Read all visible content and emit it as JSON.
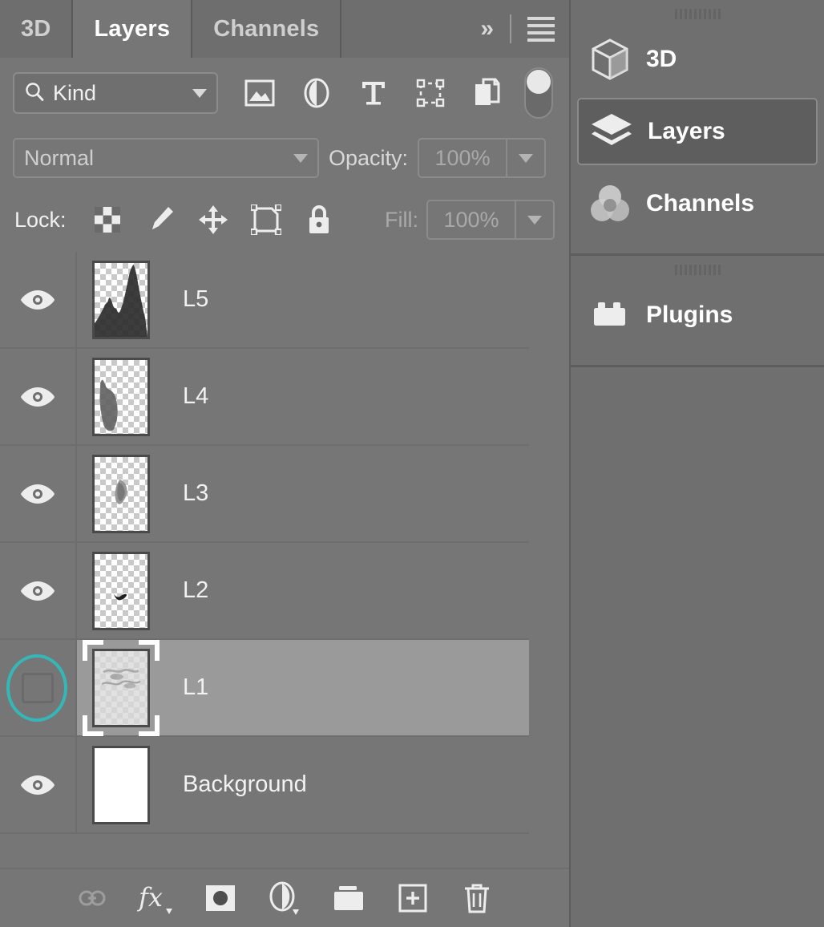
{
  "panel": {
    "tabs": [
      {
        "label": "3D",
        "active": false
      },
      {
        "label": "Layers",
        "active": true
      },
      {
        "label": "Channels",
        "active": false
      }
    ],
    "overflow_label": "»",
    "menu_icon": "hamburger-menu-icon",
    "filter": {
      "search_icon": "search-icon",
      "kind_label": "Kind",
      "dropdown_icon": "chevron-down-icon",
      "type_filters": [
        {
          "name": "filter-pixel-layers-icon"
        },
        {
          "name": "filter-adjustment-layers-icon"
        },
        {
          "name": "filter-type-layers-icon"
        },
        {
          "name": "filter-shape-layers-icon"
        },
        {
          "name": "filter-smart-object-layers-icon"
        }
      ],
      "toggle_name": "filter-enable-toggle"
    },
    "blend": {
      "mode": "Normal",
      "opacity_label": "Opacity:",
      "opacity_value": "100%"
    },
    "lock": {
      "label": "Lock:",
      "items": [
        {
          "name": "lock-transparent-pixels-icon"
        },
        {
          "name": "lock-image-pixels-icon"
        },
        {
          "name": "lock-position-icon"
        },
        {
          "name": "lock-artboard-nesting-icon"
        },
        {
          "name": "lock-all-icon"
        }
      ],
      "fill_label": "Fill:",
      "fill_value": "100%"
    },
    "layers": [
      {
        "name": "L5",
        "visible": true,
        "selected": false,
        "thumb": "smoke-peaks"
      },
      {
        "name": "L4",
        "visible": true,
        "selected": false,
        "thumb": "smoke-slope"
      },
      {
        "name": "L3",
        "visible": true,
        "selected": false,
        "thumb": "small-blob"
      },
      {
        "name": "L2",
        "visible": true,
        "selected": false,
        "thumb": "tiny-bird"
      },
      {
        "name": "L1",
        "visible": false,
        "selected": true,
        "thumb": "soft-cloud"
      },
      {
        "name": "Background",
        "visible": true,
        "selected": false,
        "thumb": "white-fill"
      }
    ],
    "bottom_tools": [
      {
        "name": "link-layers-icon",
        "enabled": false
      },
      {
        "name": "layer-styles-fx-icon",
        "enabled": true
      },
      {
        "name": "add-layer-mask-icon",
        "enabled": true
      },
      {
        "name": "new-adjustment-layer-icon",
        "enabled": true
      },
      {
        "name": "new-group-icon",
        "enabled": true
      },
      {
        "name": "new-layer-icon",
        "enabled": true
      },
      {
        "name": "delete-layer-icon",
        "enabled": true
      }
    ]
  },
  "dock": {
    "group1": [
      {
        "label": "3D",
        "icon": "cube-3d-icon",
        "active": false
      },
      {
        "label": "Layers",
        "icon": "layers-stack-icon",
        "active": true
      },
      {
        "label": "Channels",
        "icon": "channels-circles-icon",
        "active": false
      }
    ],
    "group2": [
      {
        "label": "Plugins",
        "icon": "plugins-brick-icon",
        "active": false
      }
    ]
  },
  "colors": {
    "panel_bg": "#767676",
    "tab_inactive_bg": "#6e6e6e",
    "selected_row_bg": "#9a9a9a",
    "highlight_ring": "#35b7b7",
    "dock_bg": "#6f6f6f",
    "dock_active_bg": "#5e5e5e",
    "text": "#f2f2f2"
  }
}
